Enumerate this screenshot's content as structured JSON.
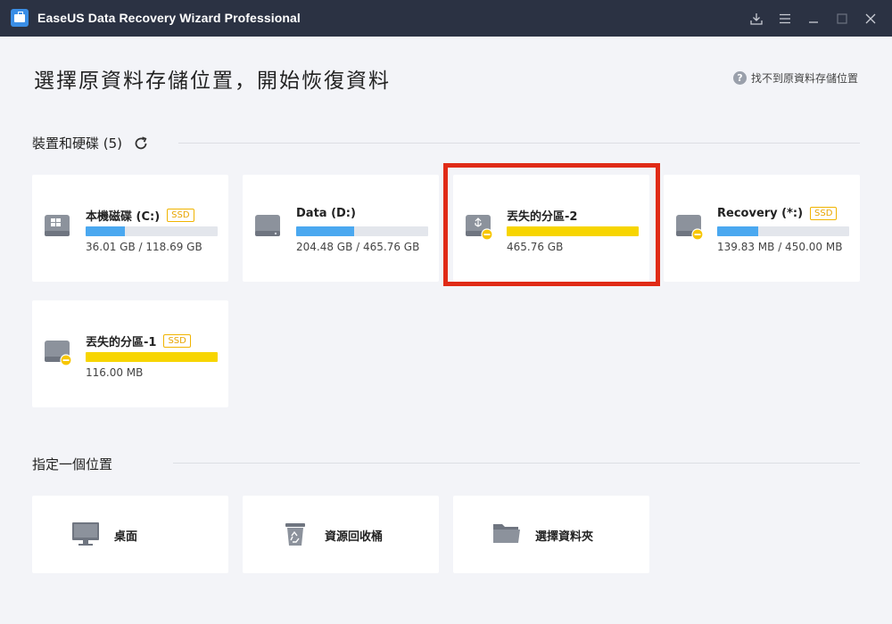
{
  "window": {
    "title": "EaseUS Data Recovery Wizard Professional"
  },
  "header": {
    "title": "選擇原資料存儲位置，開始恢復資料",
    "help_link": "找不到原資料存儲位置"
  },
  "devices_section": {
    "label": "裝置和硬碟 (5)",
    "drives": [
      {
        "name": "本機磁碟 (C:)",
        "badge": "SSD",
        "usage": "36.01 GB / 118.69 GB",
        "fill": 0.3,
        "color": "blue",
        "icon": "windows-drive-icon"
      },
      {
        "name": "Data (D:)",
        "badge": "",
        "usage": "204.48 GB / 465.76 GB",
        "fill": 0.44,
        "color": "blue",
        "icon": "hard-drive-icon"
      },
      {
        "name": "丟失的分區-2",
        "badge": "",
        "usage": "465.76 GB",
        "fill": 1.0,
        "color": "yellow",
        "icon": "usb-lost-drive-icon"
      },
      {
        "name": "Recovery (*:)",
        "badge": "SSD",
        "usage": "139.83 MB / 450.00 MB",
        "fill": 0.31,
        "color": "blue",
        "icon": "lost-drive-icon"
      },
      {
        "name": "丟失的分區-1",
        "badge": "SSD",
        "usage": "116.00 MB",
        "fill": 1.0,
        "color": "yellow",
        "icon": "lost-drive-icon"
      }
    ]
  },
  "locations_section": {
    "label": "指定一個位置",
    "items": [
      {
        "label": "桌面",
        "icon": "desktop-icon"
      },
      {
        "label": "資源回收桶",
        "icon": "recycle-bin-icon"
      },
      {
        "label": "選擇資料夾",
        "icon": "folder-icon"
      }
    ]
  },
  "colors": {
    "titlebar": "#2b3243",
    "background": "#f3f4f8",
    "bar_blue": "#4aa8f0",
    "bar_yellow": "#f7d500",
    "highlight": "#e02b17",
    "ssd_badge": "#f0b400"
  }
}
